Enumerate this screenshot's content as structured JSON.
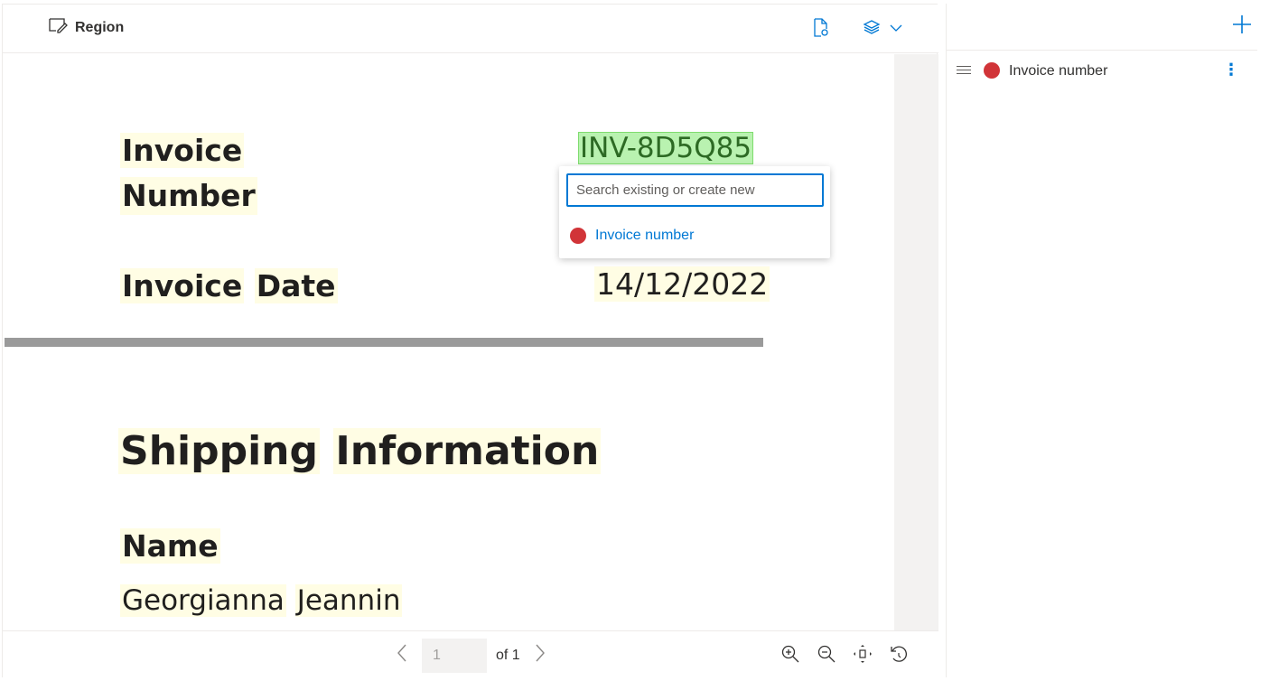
{
  "toolbar": {
    "region_label": "Region"
  },
  "document": {
    "invoice_number_label_line1": "Invoice",
    "invoice_number_label_line2": "Number",
    "invoice_number_value": "INV-8D5Q85",
    "invoice_date_label_word1": "Invoice",
    "invoice_date_label_word2": "Date",
    "invoice_date_value": "14/12/2022",
    "shipping_heading_word1": "Shipping",
    "shipping_heading_word2": "Information",
    "name_label": "Name",
    "name_value_first": "Georgianna",
    "name_value_last": "Jeannin"
  },
  "popup": {
    "search_placeholder": "Search existing or create new",
    "item_label": "Invoice number",
    "item_color": "#d13438"
  },
  "pager": {
    "current_page": "1",
    "of_text": "of 1"
  },
  "fields_panel": {
    "items": [
      {
        "label": "Invoice number",
        "color": "#d13438"
      }
    ]
  },
  "colors": {
    "accent": "#0078d4",
    "highlight": "#fffde4",
    "selected": "#b9f2b0"
  }
}
